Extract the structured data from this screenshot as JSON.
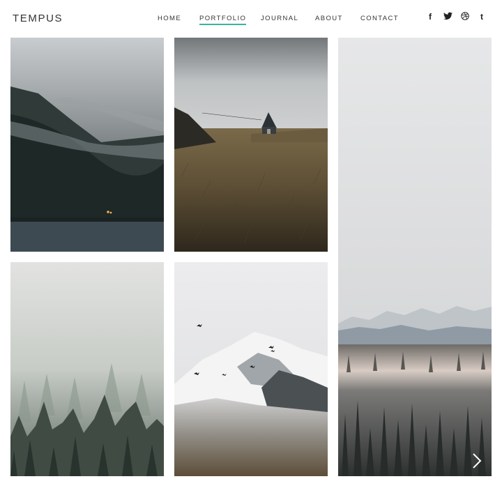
{
  "header": {
    "logo": "TEMPUS",
    "nav": [
      {
        "label": "HOME",
        "active": false
      },
      {
        "label": "PORTFOLIO",
        "active": true
      },
      {
        "label": "JOURNAL",
        "active": false
      },
      {
        "label": "ABOUT",
        "active": false
      },
      {
        "label": "CONTACT",
        "active": false
      }
    ],
    "social": [
      {
        "icon": "facebook-icon",
        "glyph": "f"
      },
      {
        "icon": "twitter-icon",
        "glyph": "🐦"
      },
      {
        "icon": "dribbble-icon",
        "glyph": "◍"
      },
      {
        "icon": "tumblr-icon",
        "glyph": "t"
      }
    ]
  },
  "gallery": [
    {
      "name": "misty-forest-lake"
    },
    {
      "name": "hut-in-grass"
    },
    {
      "name": "snowy-mountain-forest"
    },
    {
      "name": "foggy-pines"
    },
    {
      "name": "birds-over-mountain"
    }
  ],
  "colors": {
    "accent": "#3bb29e"
  }
}
